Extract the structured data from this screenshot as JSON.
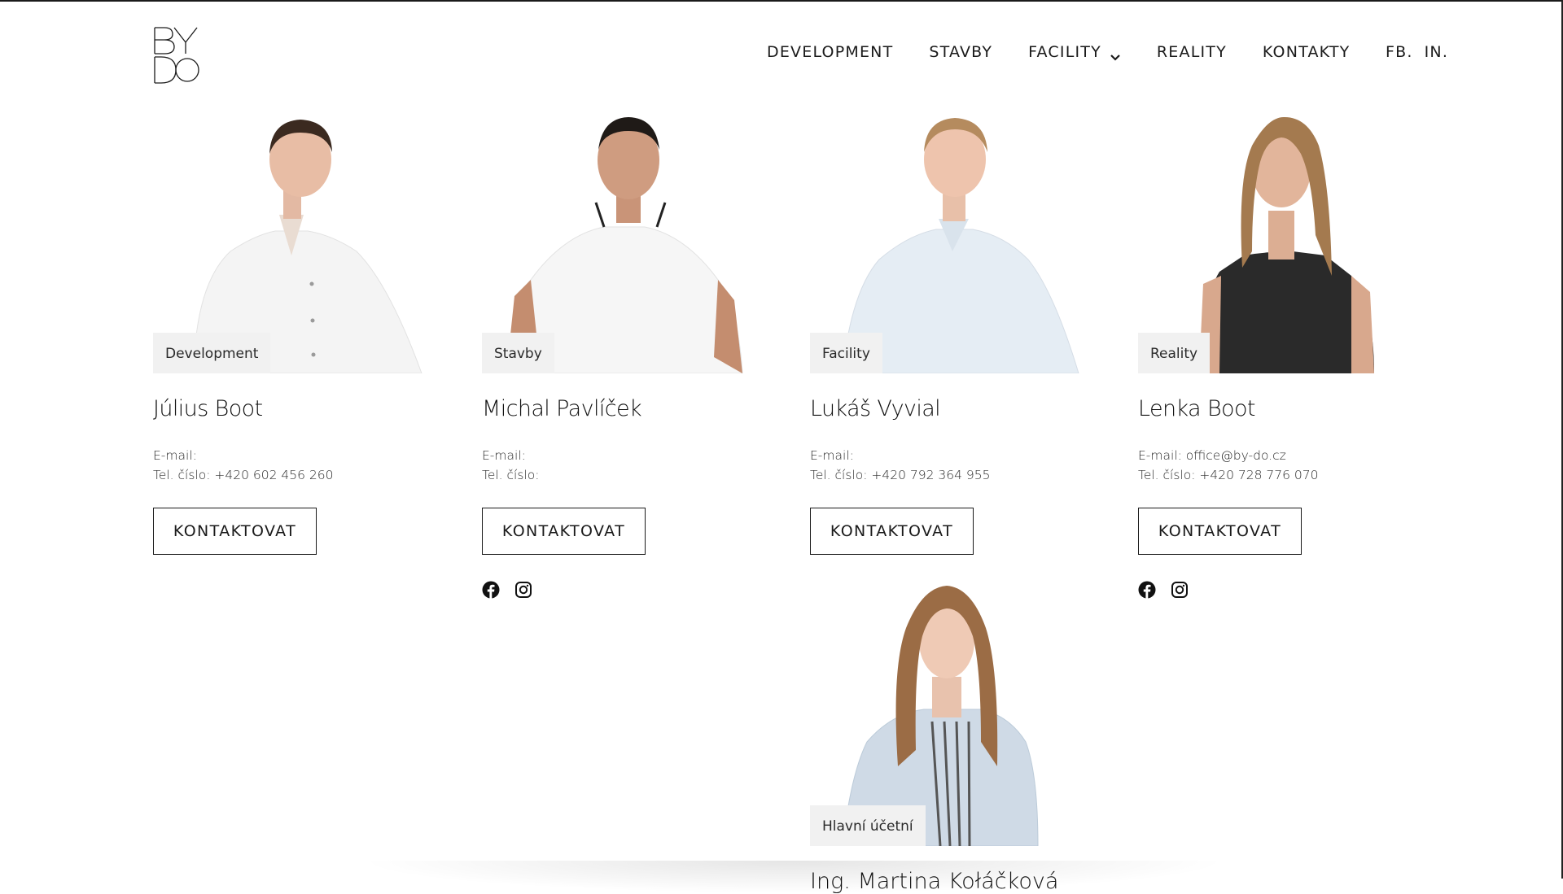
{
  "brand": {
    "logo_text": "BY DO"
  },
  "nav": {
    "items": [
      {
        "label": "DEVELOPMENT"
      },
      {
        "label": "STAVBY"
      },
      {
        "label": "FACILITY",
        "has_dropdown": true
      },
      {
        "label": "REALITY"
      },
      {
        "label": "KONTAKTY"
      }
    ],
    "social": [
      {
        "label": "FB."
      },
      {
        "label": "IN."
      }
    ]
  },
  "team": [
    {
      "role": "Development",
      "name": "Július Boot",
      "email_label": "E-mail:",
      "email": "",
      "phone_label": "Tel. číslo:",
      "phone": "+420 602 456 260",
      "button": "KONTAKTOVAT",
      "socials": []
    },
    {
      "role": "Stavby",
      "name": "Michal Pavlíček",
      "email_label": "E-mail:",
      "email": "",
      "phone_label": "Tel. číslo:",
      "phone": "",
      "button": "KONTAKTOVAT",
      "socials": [
        "facebook-icon",
        "instagram-icon"
      ]
    },
    {
      "role": "Facility",
      "name": "Lukáš Vyvial",
      "email_label": "E-mail:",
      "email": "",
      "phone_label": "Tel. číslo:",
      "phone": "+420 792 364 955",
      "button": "KONTAKTOVAT",
      "socials": []
    },
    {
      "role": "Reality",
      "name": "Lenka Boot",
      "email_label": "E-mail:",
      "email": "office@by-do.cz",
      "phone_label": "Tel. číslo:",
      "phone": "+420 728 776 070",
      "button": "KONTAKTOVAT",
      "socials": [
        "facebook-icon",
        "instagram-icon"
      ]
    }
  ],
  "fifth_member": {
    "role": "Hlavní účetní",
    "name_cut": "Ing. Martina Kołáčková"
  },
  "colors": {
    "text": "#1a1a1a",
    "badge_bg": "#f1f1f1",
    "page_bg": "#ffffff"
  }
}
